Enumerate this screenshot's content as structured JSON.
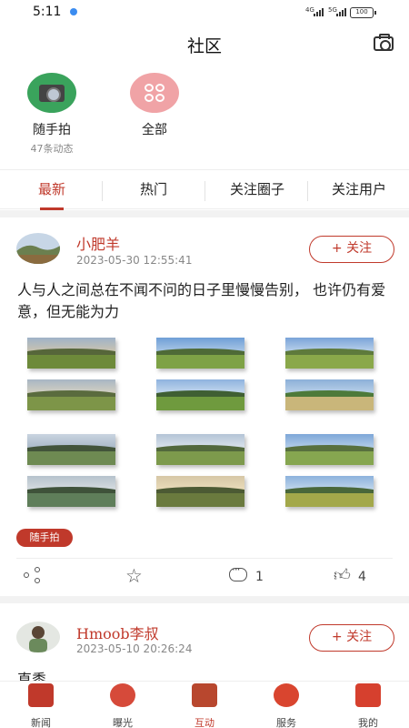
{
  "status_bar": {
    "time": "5:11",
    "signal1": "4G",
    "signal2": "5G",
    "battery": "100"
  },
  "header": {
    "title": "社区",
    "camera_icon": "camera-icon"
  },
  "categories": [
    {
      "name": "随手拍",
      "count": "47条动态",
      "icon": "camera-icon",
      "color": "#3aa35c"
    },
    {
      "name": "全部",
      "count": "",
      "icon": "grid-icon",
      "color": "#f0a3a6"
    }
  ],
  "tabs": [
    {
      "label": "最新",
      "active": true
    },
    {
      "label": "热门",
      "active": false
    },
    {
      "label": "关注圈子",
      "active": false
    },
    {
      "label": "关注用户",
      "active": false
    }
  ],
  "posts": [
    {
      "author": "小肥羊",
      "time": "2023-05-30 12:55:41",
      "follow_label": "+ 关注",
      "content": "人与人之间总在不闻不问的日子里慢慢告别， 也许仍有爱意，但无能为力",
      "tag": "随手拍",
      "actions": {
        "comments": "1",
        "likes": "4"
      }
    },
    {
      "author": "Hmoob李叔",
      "time": "2023-05-10 20:26:24",
      "follow_label": "+ 关注",
      "content": "直黍"
    }
  ],
  "bottom_nav": [
    {
      "label": "新闻",
      "icon": "news-icon",
      "active": false
    },
    {
      "label": "曝光",
      "icon": "exposure-icon",
      "active": false
    },
    {
      "label": "互动",
      "icon": "interact-icon",
      "active": true
    },
    {
      "label": "服务",
      "icon": "service-icon",
      "active": false
    },
    {
      "label": "我的",
      "icon": "profile-icon",
      "active": false
    }
  ],
  "colors": {
    "accent": "#c0392b",
    "gap": "#f2f2f2"
  }
}
